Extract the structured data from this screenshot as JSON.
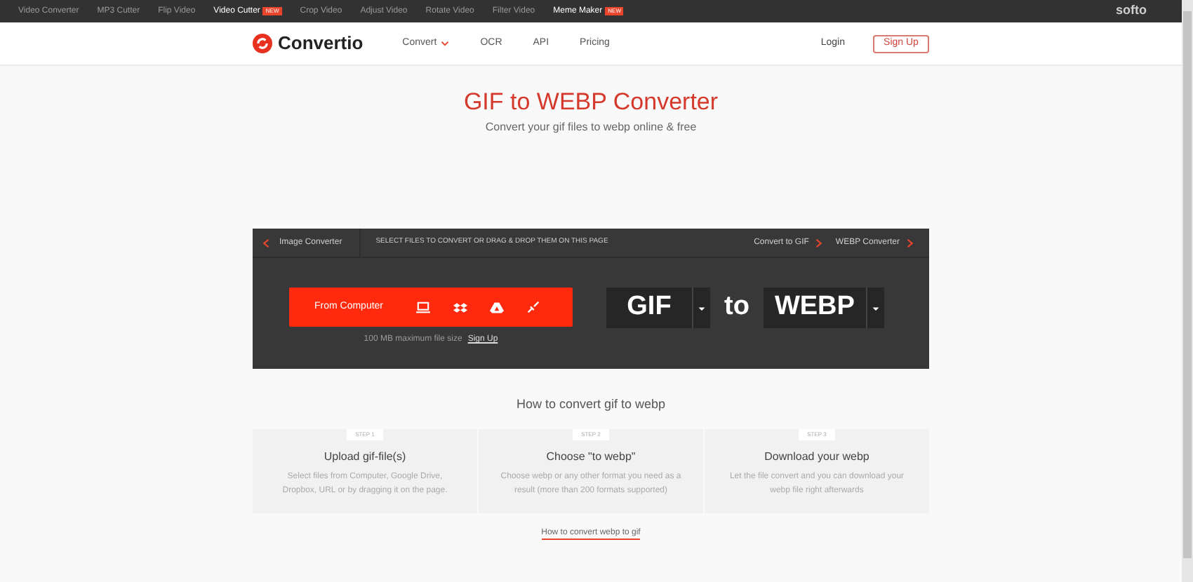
{
  "topbar": {
    "items": [
      {
        "label": "Video Converter",
        "highlighted": false
      },
      {
        "label": "MP3 Cutter",
        "highlighted": false
      },
      {
        "label": "Flip Video",
        "highlighted": false
      },
      {
        "label": "Video Cutter",
        "highlighted": true,
        "badge": "NEW"
      },
      {
        "label": "Crop Video",
        "highlighted": false
      },
      {
        "label": "Adjust Video",
        "highlighted": false
      },
      {
        "label": "Rotate Video",
        "highlighted": false
      },
      {
        "label": "Filter Video",
        "highlighted": false
      },
      {
        "label": "Meme Maker",
        "highlighted": true,
        "badge": "NEW"
      }
    ],
    "brand": "softo"
  },
  "header": {
    "logo": "Convertio",
    "nav": [
      {
        "label": "Convert",
        "dropdown": true
      },
      {
        "label": "OCR",
        "dropdown": false
      },
      {
        "label": "API",
        "dropdown": false
      },
      {
        "label": "Pricing",
        "dropdown": false
      }
    ],
    "login": "Login",
    "signup": "Sign Up"
  },
  "hero": {
    "title": "GIF to WEBP Converter",
    "subtitle": "Convert your gif files to webp online & free"
  },
  "converter": {
    "back": "Image Converter",
    "instruction": "SELECT FILES TO CONVERT OR DRAG & DROP THEM ON THIS PAGE",
    "crumbs": [
      "Convert to GIF",
      "WEBP Converter"
    ],
    "upload": "From Computer",
    "limit": "100 MB maximum file size",
    "limit_link": "Sign Up",
    "from": "GIF",
    "to_word": "to",
    "to": "WEBP"
  },
  "howto": {
    "title": "How to convert gif to webp",
    "steps": [
      {
        "step": "STEP 1",
        "title": "Upload gif-file(s)",
        "text": "Select files from Computer, Google Drive, Dropbox, URL or by dragging it on the page."
      },
      {
        "step": "STEP 2",
        "title": "Choose \"to webp\"",
        "text": "Choose webp or any other format you need as a result (more than 200 formats supported)"
      },
      {
        "step": "STEP 3",
        "title": "Download your webp",
        "text": "Let the file convert and you can download your webp file right afterwards"
      }
    ],
    "link": "How to convert webp to gif"
  }
}
